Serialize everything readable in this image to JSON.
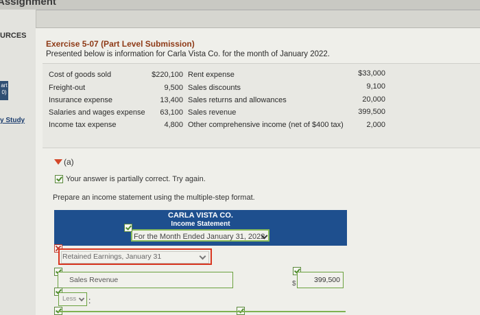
{
  "browser": {
    "partial_tab_text": "Assignment"
  },
  "left_nav": {
    "resources_label": "URCES",
    "part_badge": "art\n0)",
    "study_link": "y Study"
  },
  "exercise": {
    "title": "Exercise 5-07 (Part Level Submission)",
    "intro": "Presented below is information for Carla Vista Co. for the month of January 2022.",
    "items_left": [
      {
        "label": "Cost of goods sold",
        "amount": "$220,100"
      },
      {
        "label": "Freight-out",
        "amount": "9,500"
      },
      {
        "label": "Insurance expense",
        "amount": "13,400"
      },
      {
        "label": "Salaries and wages expense",
        "amount": "63,100"
      },
      {
        "label": "Income tax expense",
        "amount": "4,800"
      }
    ],
    "items_right": [
      {
        "label": "Rent expense",
        "amount": "$33,000"
      },
      {
        "label": "Sales discounts",
        "amount": "9,100"
      },
      {
        "label": "Sales returns and allowances",
        "amount": "20,000"
      },
      {
        "label": "Sales revenue",
        "amount": "399,500"
      },
      {
        "label": "Other comprehensive income (net of $400 tax)",
        "amount": "2,000"
      }
    ]
  },
  "part_a": {
    "label": "(a)",
    "feedback": "Your answer is partially correct.  Try again.",
    "instruction": "Prepare an income statement using the multiple-step format."
  },
  "statement": {
    "company": "CARLA VISTA CO.",
    "name": "Income Statement",
    "period_selected": "For the Month Ended January 31, 2022"
  },
  "rows": {
    "row1_value": "Retained Earnings, January 31",
    "row2_label": "Sales Revenue",
    "row2_amount": "399,500",
    "row2_currency": "$",
    "row3_select": "Less",
    "row3_colon": ":"
  },
  "colors": {
    "accent_header": "#1e4f8e",
    "error": "#d8341e",
    "correct": "#6aa13e",
    "title": "#8e3a16"
  }
}
